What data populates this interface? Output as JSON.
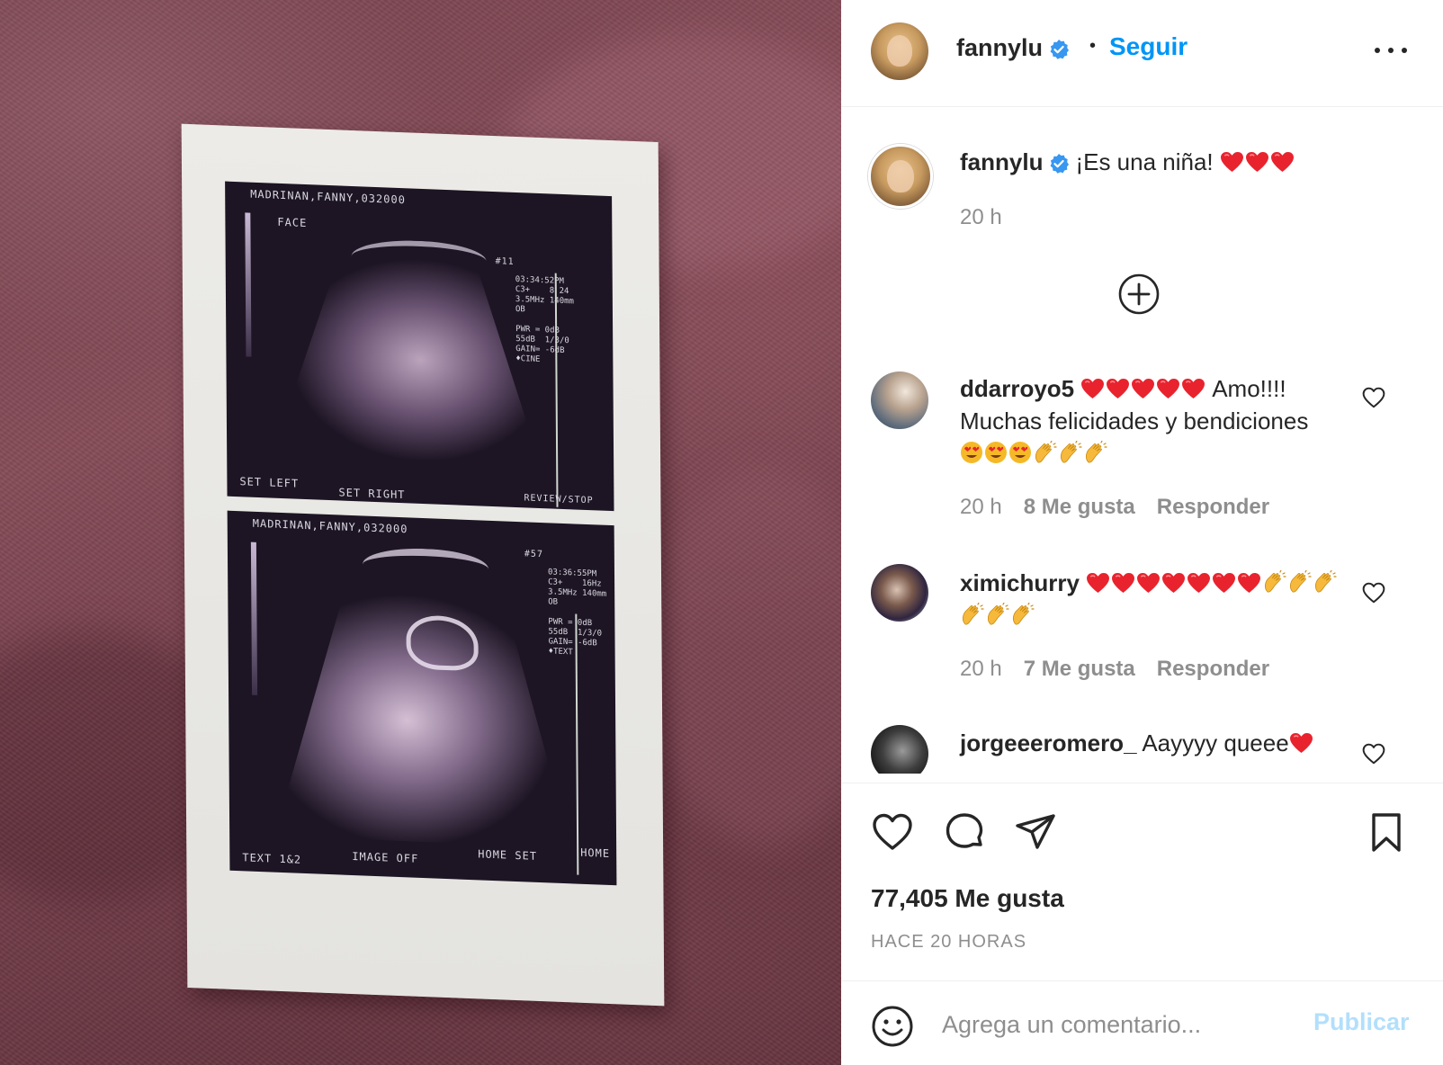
{
  "post": {
    "image_alt": "ultrasound photo",
    "scan_top": {
      "patient": "MADRINAN,FANNY,032000",
      "mode": "FACE",
      "frame": "#11",
      "readout": "03:34:52PM\nC3+    8 24\n3.5MHz 140mm\nOB\n\nPWR = 0dB\n55dB  1/3/0\nGAIN= -6dB\n♦CINE",
      "footer_left": "SET LEFT",
      "footer_mid": "SET RIGHT",
      "footer_right": "REVIEW/STOP"
    },
    "scan_bottom": {
      "patient": "MADRINAN,FANNY,032000",
      "frame": "#57",
      "readout": "03:36:55PM\nC3+    16Hz\n3.5MHz 140mm\nOB\n\nPWR = 0dB\n55dB  1/3/0\nGAIN= -6dB\n♦TEXT",
      "footer_1": "TEXT 1&2",
      "footer_2": "IMAGE OFF",
      "footer_3": "HOME SET",
      "footer_4": "HOME"
    }
  },
  "header": {
    "username": "fannylu",
    "separator": "•",
    "follow_label": "Seguir"
  },
  "caption": {
    "username": "fannylu",
    "text": "¡Es una niña!",
    "emojis": [
      "red-heart",
      "red-heart",
      "red-heart"
    ],
    "time": "20 h"
  },
  "comments": [
    {
      "username": "ddarroyo5",
      "text_after_emoji": "Amo!!!!",
      "line2": "Muchas felicidades y bendiciones",
      "time": "20 h",
      "likes": "8 Me gusta",
      "reply_label": "Responder"
    },
    {
      "username": "ximichurry",
      "time": "20 h",
      "likes": "7 Me gusta",
      "reply_label": "Responder"
    },
    {
      "username": "jorgeeeromero_",
      "text": "Aayyyy queee"
    }
  ],
  "stats": {
    "likes": "77,405 Me gusta",
    "posted": "HACE 20 HORAS"
  },
  "comment_box": {
    "placeholder": "Agrega un comentario...",
    "publish_label": "Publicar"
  },
  "colors": {
    "link_blue": "#0095f6",
    "disabled_blue": "#b2dffc",
    "secondary_text": "#8e8e8e",
    "primary_text": "#262626",
    "verified_badge": "#3897f0",
    "heart_red": "#e0245e"
  }
}
